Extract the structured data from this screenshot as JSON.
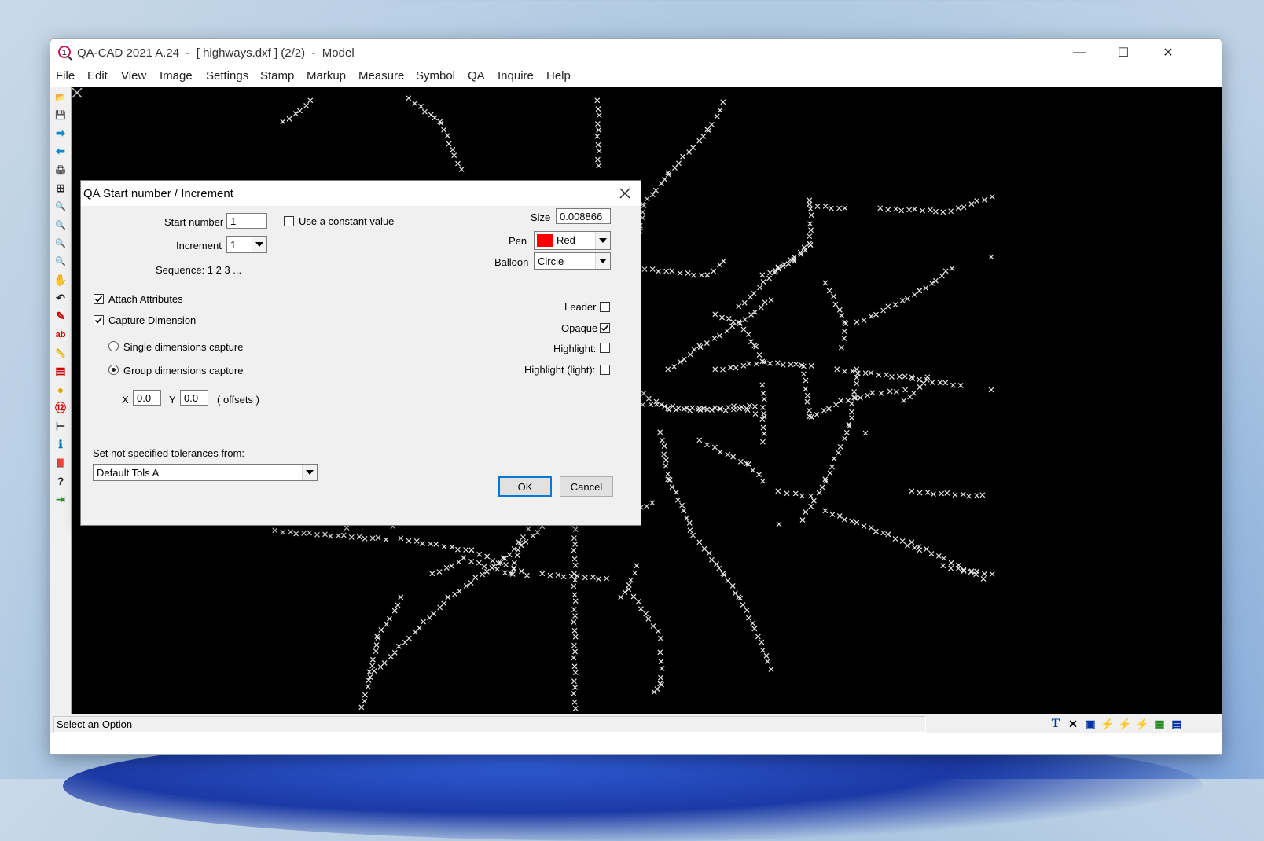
{
  "window": {
    "title": "QA-CAD 2021 A.24  -  [ highways.dxf ] (2/2)  -  Model",
    "minimize": "—",
    "maximize": "☐",
    "close": "✕"
  },
  "menu": [
    "File",
    "Edit",
    "View",
    "Image",
    "Settings",
    "Stamp",
    "Markup",
    "Measure",
    "Symbol",
    "QA",
    "Inquire",
    "Help"
  ],
  "toolbar_icons": [
    "open-icon",
    "save-icon",
    "forward-icon",
    "back-icon",
    "print-icon",
    "plotter-icon",
    "zoom-icon",
    "zoom-in-icon",
    "zoom-out-icon",
    "zoom-extents-icon",
    "pan-hand-icon",
    "undo-icon",
    "pencil-icon",
    "text-icon",
    "measure-icon",
    "table-icon",
    "balloon-icon",
    "numbering-icon",
    "dimension-icon",
    "info-icon",
    "book-icon",
    "help-icon",
    "exit-icon"
  ],
  "status": {
    "text": "Select an Option",
    "icons": [
      "T",
      "✕",
      "▣",
      "⚡",
      "⚡",
      "⚡",
      "▦",
      "▤"
    ]
  },
  "dialog": {
    "title": "QA Start number / Increment",
    "start_number_label": "Start number",
    "start_number": "1",
    "use_constant_label": "Use a constant value",
    "use_constant": false,
    "increment_label": "Increment",
    "increment": "1",
    "sequence": "Sequence:  1 2 3 ...",
    "size_label": "Size",
    "size": "0.008866",
    "pen_label": "Pen",
    "pen": "Red",
    "pen_color": "#ff0000",
    "balloon_label": "Balloon",
    "balloon": "Circle",
    "attach_attributes_label": "Attach Attributes",
    "attach_attributes": true,
    "capture_dimension_label": "Capture Dimension",
    "capture_dimension": true,
    "single_capture_label": "Single dimensions capture",
    "group_capture_label": "Group dimensions capture",
    "capture_mode": "group",
    "x_label": "X",
    "x_offset": "0.0",
    "y_label": "Y",
    "y_offset": "0.0",
    "offsets_label": "( offsets )",
    "leader_label": "Leader",
    "leader": false,
    "opaque_label": "Opaque",
    "opaque": true,
    "highlight_label": "Highlight:",
    "highlight": false,
    "highlight_light_label": "Highlight (light):",
    "highlight_light": false,
    "tolerances_label": "Set not specified tolerances from:",
    "tolerances": "Default Tols A",
    "ok": "OK",
    "cancel": "Cancel"
  }
}
